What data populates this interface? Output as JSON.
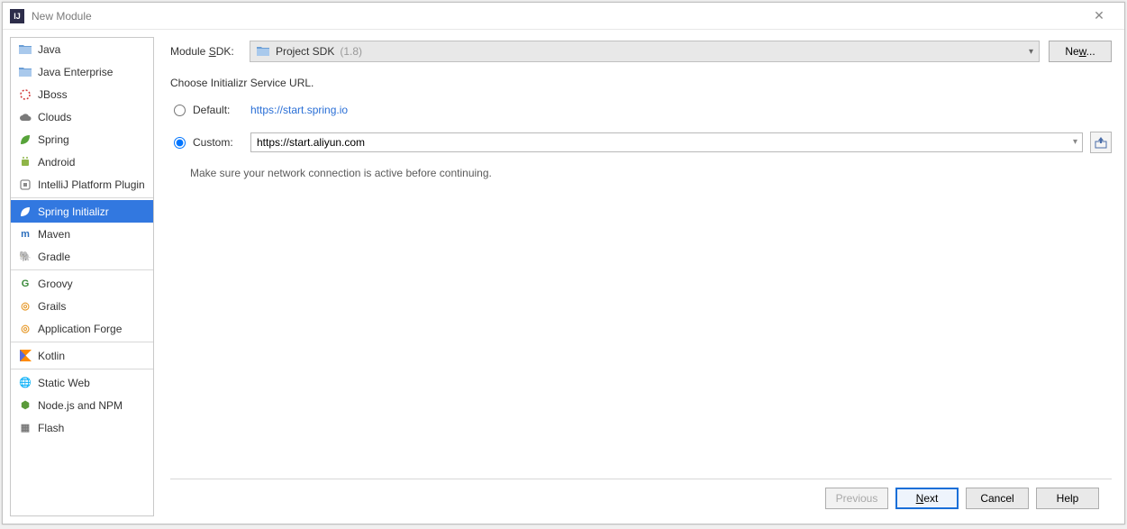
{
  "window": {
    "title": "New Module",
    "app_icon_text": "IJ"
  },
  "sidebar": {
    "groups": [
      {
        "items": [
          {
            "id": "java",
            "label": "Java",
            "icon": "folder-icon",
            "color": "#6b9ed6"
          },
          {
            "id": "java-enterprise",
            "label": "Java Enterprise",
            "icon": "folder-ee-icon",
            "color": "#6b9ed6"
          },
          {
            "id": "jboss",
            "label": "JBoss",
            "icon": "jboss-icon",
            "color": "#d03636"
          },
          {
            "id": "clouds",
            "label": "Clouds",
            "icon": "cloud-icon",
            "color": "#7a7a7a"
          },
          {
            "id": "spring",
            "label": "Spring",
            "icon": "leaf-icon",
            "color": "#57a33a"
          },
          {
            "id": "android",
            "label": "Android",
            "icon": "android-icon",
            "color": "#8fb548"
          },
          {
            "id": "intellij-plugin",
            "label": "IntelliJ Platform Plugin",
            "icon": "plugin-icon",
            "color": "#8a8a8a"
          }
        ]
      },
      {
        "items": [
          {
            "id": "spring-initializr",
            "label": "Spring Initializr",
            "icon": "leaf-icon",
            "color": "#57a33a",
            "selected": true
          },
          {
            "id": "maven",
            "label": "Maven",
            "icon": "maven-icon",
            "color": "#2c6fbd",
            "glyph": "m"
          },
          {
            "id": "gradle",
            "label": "Gradle",
            "icon": "gradle-icon",
            "color": "#5e6b6b",
            "glyph": "🐘"
          }
        ]
      },
      {
        "items": [
          {
            "id": "groovy",
            "label": "Groovy",
            "icon": "groovy-icon",
            "color": "#3b8a3b",
            "glyph": "G"
          },
          {
            "id": "grails",
            "label": "Grails",
            "icon": "grails-icon",
            "color": "#e79a2b",
            "glyph": "◎"
          },
          {
            "id": "app-forge",
            "label": "Application Forge",
            "icon": "forge-icon",
            "color": "#e79a2b",
            "glyph": "◎"
          }
        ]
      },
      {
        "items": [
          {
            "id": "kotlin",
            "label": "Kotlin",
            "icon": "kotlin-icon",
            "color": "#ff8a00",
            "glyph": "K"
          }
        ]
      },
      {
        "items": [
          {
            "id": "static-web",
            "label": "Static Web",
            "icon": "globe-icon",
            "color": "#8a8a8a",
            "glyph": "🌐"
          },
          {
            "id": "node",
            "label": "Node.js and NPM",
            "icon": "node-icon",
            "color": "#5a9a3a",
            "glyph": "⬢"
          },
          {
            "id": "flash",
            "label": "Flash",
            "icon": "flash-icon",
            "color": "#7a7a7a",
            "glyph": "▦"
          }
        ]
      }
    ]
  },
  "main": {
    "sdk_label": "Module SDK:",
    "sdk_value": "Project SDK",
    "sdk_version": "(1.8)",
    "new_button": "New...",
    "heading": "Choose Initializr Service URL.",
    "default_label": "Default:",
    "default_url": "https://start.spring.io",
    "custom_label": "Custom:",
    "custom_url": "https://start.aliyun.com",
    "note": "Make sure your network connection is active before continuing.",
    "selected_radio": "custom"
  },
  "footer": {
    "previous": "Previous",
    "next": "Next",
    "cancel": "Cancel",
    "help": "Help"
  }
}
